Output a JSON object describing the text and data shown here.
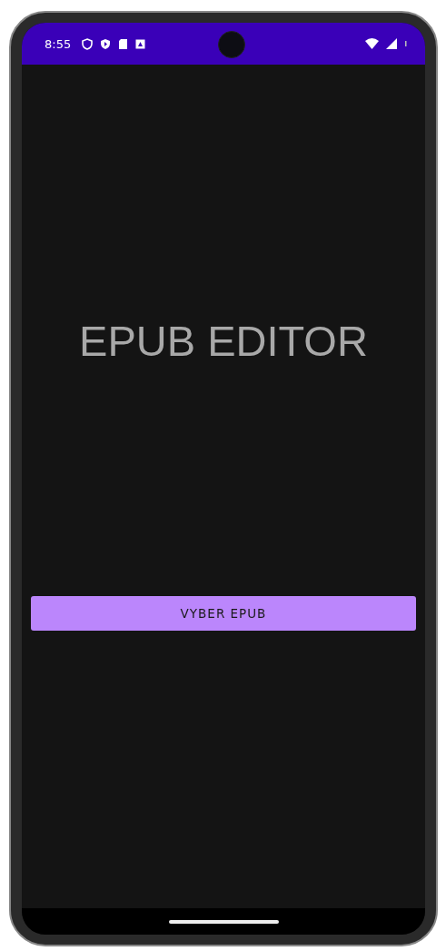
{
  "status_bar": {
    "time": "8:55"
  },
  "app": {
    "title": "EPUB EDITOR",
    "button": "VYBER EPUB"
  }
}
